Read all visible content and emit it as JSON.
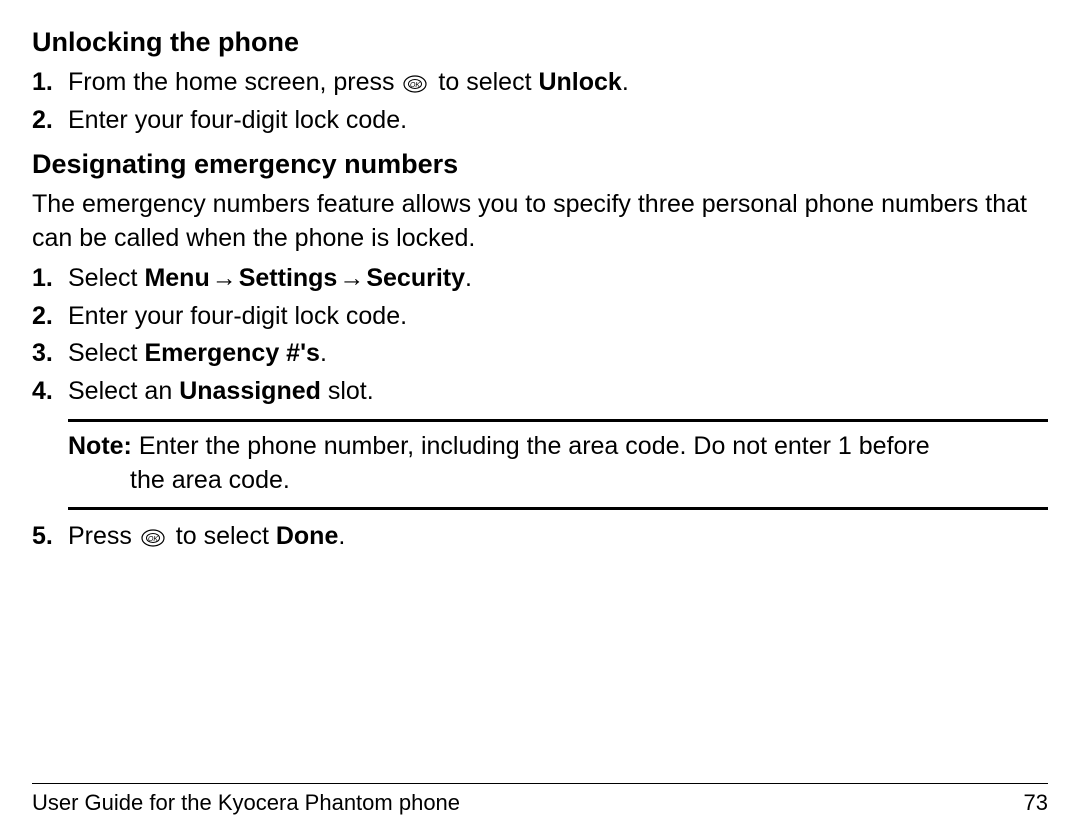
{
  "section1": {
    "heading": "Unlocking the phone",
    "steps": [
      {
        "num": "1.",
        "pre": "From the home screen, press ",
        "icon": true,
        "mid": " to select ",
        "bold1": "Unlock",
        "suffix": "."
      },
      {
        "num": "2.",
        "text": "Enter your four-digit lock code."
      }
    ]
  },
  "section2": {
    "heading": "Designating emergency numbers",
    "intro": "The emergency numbers feature allows you to specify three personal phone numbers that can be called when the phone is locked.",
    "steps": [
      {
        "num": "1.",
        "pre": "Select ",
        "bold1": "Menu",
        "arrow1": " → ",
        "bold2": "Settings",
        "arrow2": " → ",
        "bold3": "Security",
        "suffix": "."
      },
      {
        "num": "2.",
        "text": "Enter your four-digit lock code."
      },
      {
        "num": "3.",
        "pre": "Select ",
        "bold1": "Emergency #'s",
        "suffix": "."
      },
      {
        "num": "4.",
        "pre": "Select an ",
        "bold1": "Unassigned",
        "suffix": " slot."
      }
    ],
    "note": {
      "label": "Note:",
      "line1": " Enter the phone number, including the area code. Do not enter 1 before",
      "line2": "the area code."
    },
    "step5": {
      "num": "5.",
      "pre": "Press ",
      "icon": true,
      "mid": " to select ",
      "bold1": "Done",
      "suffix": "."
    }
  },
  "footer": {
    "left": "User Guide for the Kyocera Phantom phone",
    "right": "73"
  }
}
